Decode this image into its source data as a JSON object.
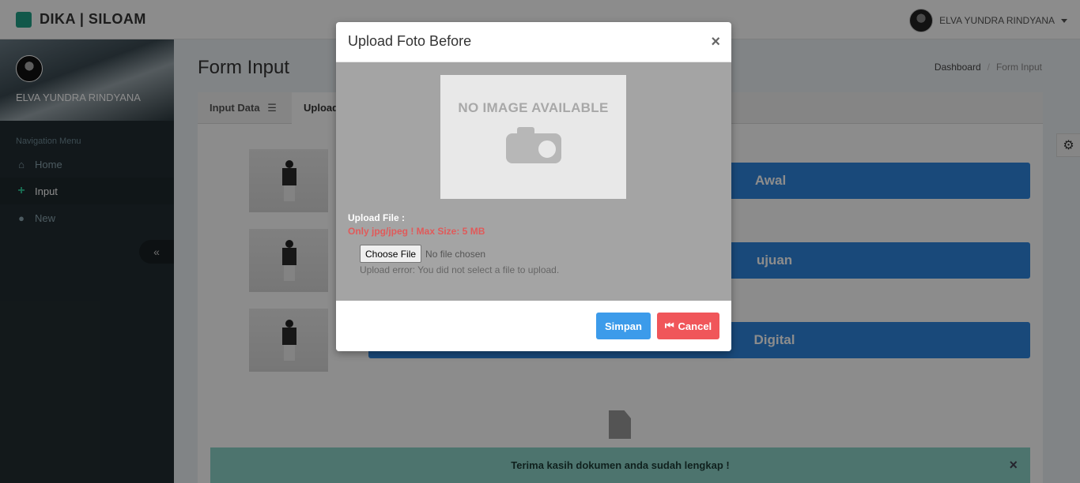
{
  "topbar": {
    "brand": "DIKA | SILOAM",
    "user_name": "ELVA YUNDRA RINDYANA"
  },
  "sidebar": {
    "user_name": "ELVA YUNDRA RINDYANA",
    "header": "Navigation Menu",
    "items": [
      {
        "label": "Home",
        "icon": "home-icon",
        "active": false
      },
      {
        "label": "Input",
        "icon": "plus-icon",
        "active": true
      },
      {
        "label": "New",
        "icon": "user-icon",
        "active": false
      }
    ],
    "collapse_icon": "double-chevron-left-icon"
  },
  "content": {
    "title": "Form Input",
    "breadcrumb": [
      "Dashboard",
      "Form Input"
    ],
    "tabs": [
      {
        "label": "Input Data",
        "icon": "database-icon"
      },
      {
        "label": "Upload",
        "icon": ""
      }
    ],
    "rows": [
      {
        "button_label": "Awal"
      },
      {
        "button_label": "ujuan"
      },
      {
        "button_label": "Digital"
      }
    ],
    "alert": {
      "message": "Terima kasih dokumen anda sudah lengkap !",
      "close": "×"
    }
  },
  "modal": {
    "title": "Upload Foto Before",
    "close": "×",
    "placeholder_text": "NO IMAGE AVAILABLE",
    "upload_label": "Upload File :",
    "upload_note": "Only jpg/jpeg ! Max Size: 5 MB",
    "choose_file": "Choose File",
    "file_status": "No file chosen",
    "upload_error": "Upload error: You did not select a file to upload.",
    "save_label": "Simpan",
    "cancel_label": "Cancel"
  },
  "colors": {
    "primary": "#3c9bea",
    "danger": "#f0565a",
    "sidebar": "#222d32",
    "alert": "#8cd4c8"
  }
}
